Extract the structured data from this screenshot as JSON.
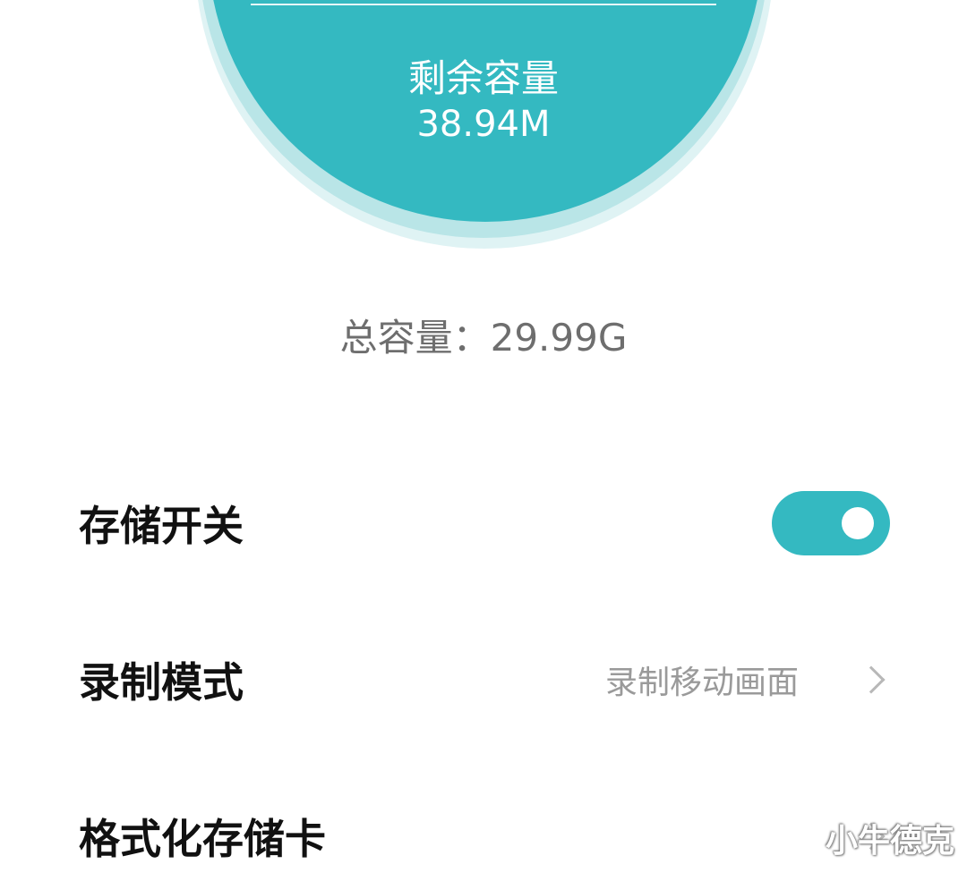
{
  "storage": {
    "remaining_label": "剩余容量",
    "remaining_value": "38.94M",
    "total_text": "总容量：29.99G"
  },
  "settings": {
    "storage_switch": {
      "label": "存储开关",
      "enabled": true
    },
    "record_mode": {
      "label": "录制模式",
      "value": "录制移动画面"
    },
    "format_card": {
      "label": "格式化存储卡"
    }
  },
  "watermark": "小牛德克",
  "colors": {
    "accent": "#34b9c1",
    "halo": "#b9e5e7",
    "text_primary": "#111111",
    "text_secondary": "#9a9a9a",
    "total_text": "#6e6e6e"
  },
  "icons": {
    "chevron": "chevron-right-icon"
  }
}
